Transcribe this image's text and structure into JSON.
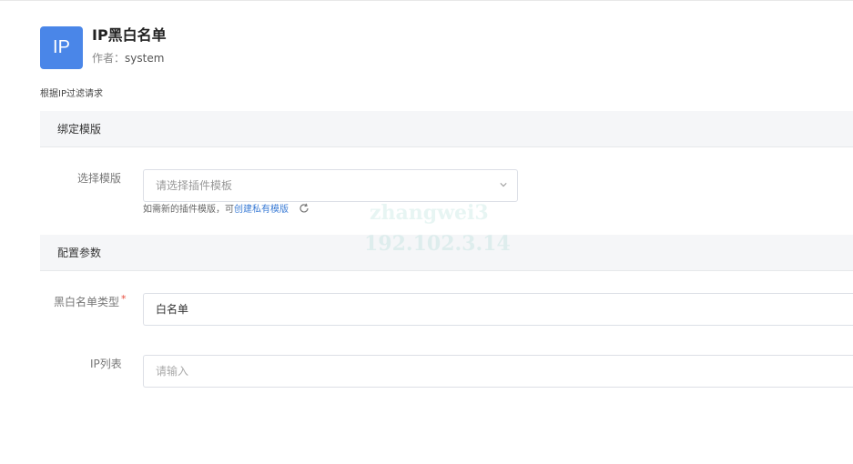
{
  "plugin": {
    "logo_text": "IP",
    "title": "IP黑白名单",
    "author_label": "作者：",
    "author_name": "system",
    "description": "根据IP过滤请求"
  },
  "sections": {
    "bind_template": {
      "title": "绑定模版"
    },
    "config_params": {
      "title": "配置参数"
    }
  },
  "template_form": {
    "select_label": "选择模版",
    "select_placeholder": "请选择插件模板",
    "hint_prefix": "如需新的插件模版，可",
    "hint_link": "创建私有模版"
  },
  "config_form": {
    "list_type_label": "黑白名单类型",
    "list_type_required": "*",
    "list_type_value": "白名单",
    "ip_list_label": "IP列表",
    "ip_list_placeholder": "请输入"
  },
  "watermark": {
    "line1": "zhangwei3",
    "line2": "192.102.3.14"
  },
  "colors": {
    "logo_bg": "#4a86e8",
    "link": "#3a7bd5",
    "required": "#e74c3c",
    "section_bg": "#f5f6f8"
  },
  "icons": {
    "select_arrow": "chevron-down-icon",
    "refresh": "refresh-icon"
  }
}
